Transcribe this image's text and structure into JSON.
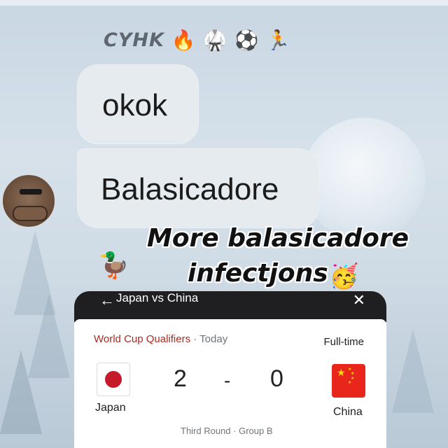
{
  "chat": {
    "sender_name": "CYHK",
    "sender_emojis": [
      "🔥",
      "🥋",
      "⚽",
      "🏃"
    ],
    "messages": [
      "okok",
      "Balasicadore"
    ],
    "avatar": "bear-avatar"
  },
  "caption": {
    "line1": "More balasicadore",
    "line2": "infectjons",
    "emoji": "🥳",
    "duck_emoji": "🦆"
  },
  "match_card": {
    "header_title": "Japan vs China",
    "back_icon": "back-arrow-icon",
    "close_icon": "close-icon",
    "competition": "World Cup Qualifiers",
    "date": "· Today",
    "status": "Full-time",
    "home_team": "Japan",
    "away_team": "China",
    "home_score": "2",
    "separator": "-",
    "away_score": "0",
    "round": "Third Round · Group B"
  },
  "colors": {
    "competition": "#a62b22",
    "japan_red": "#c41a2a",
    "china_red": "#e8261c",
    "bubble": "#e6ebef"
  }
}
